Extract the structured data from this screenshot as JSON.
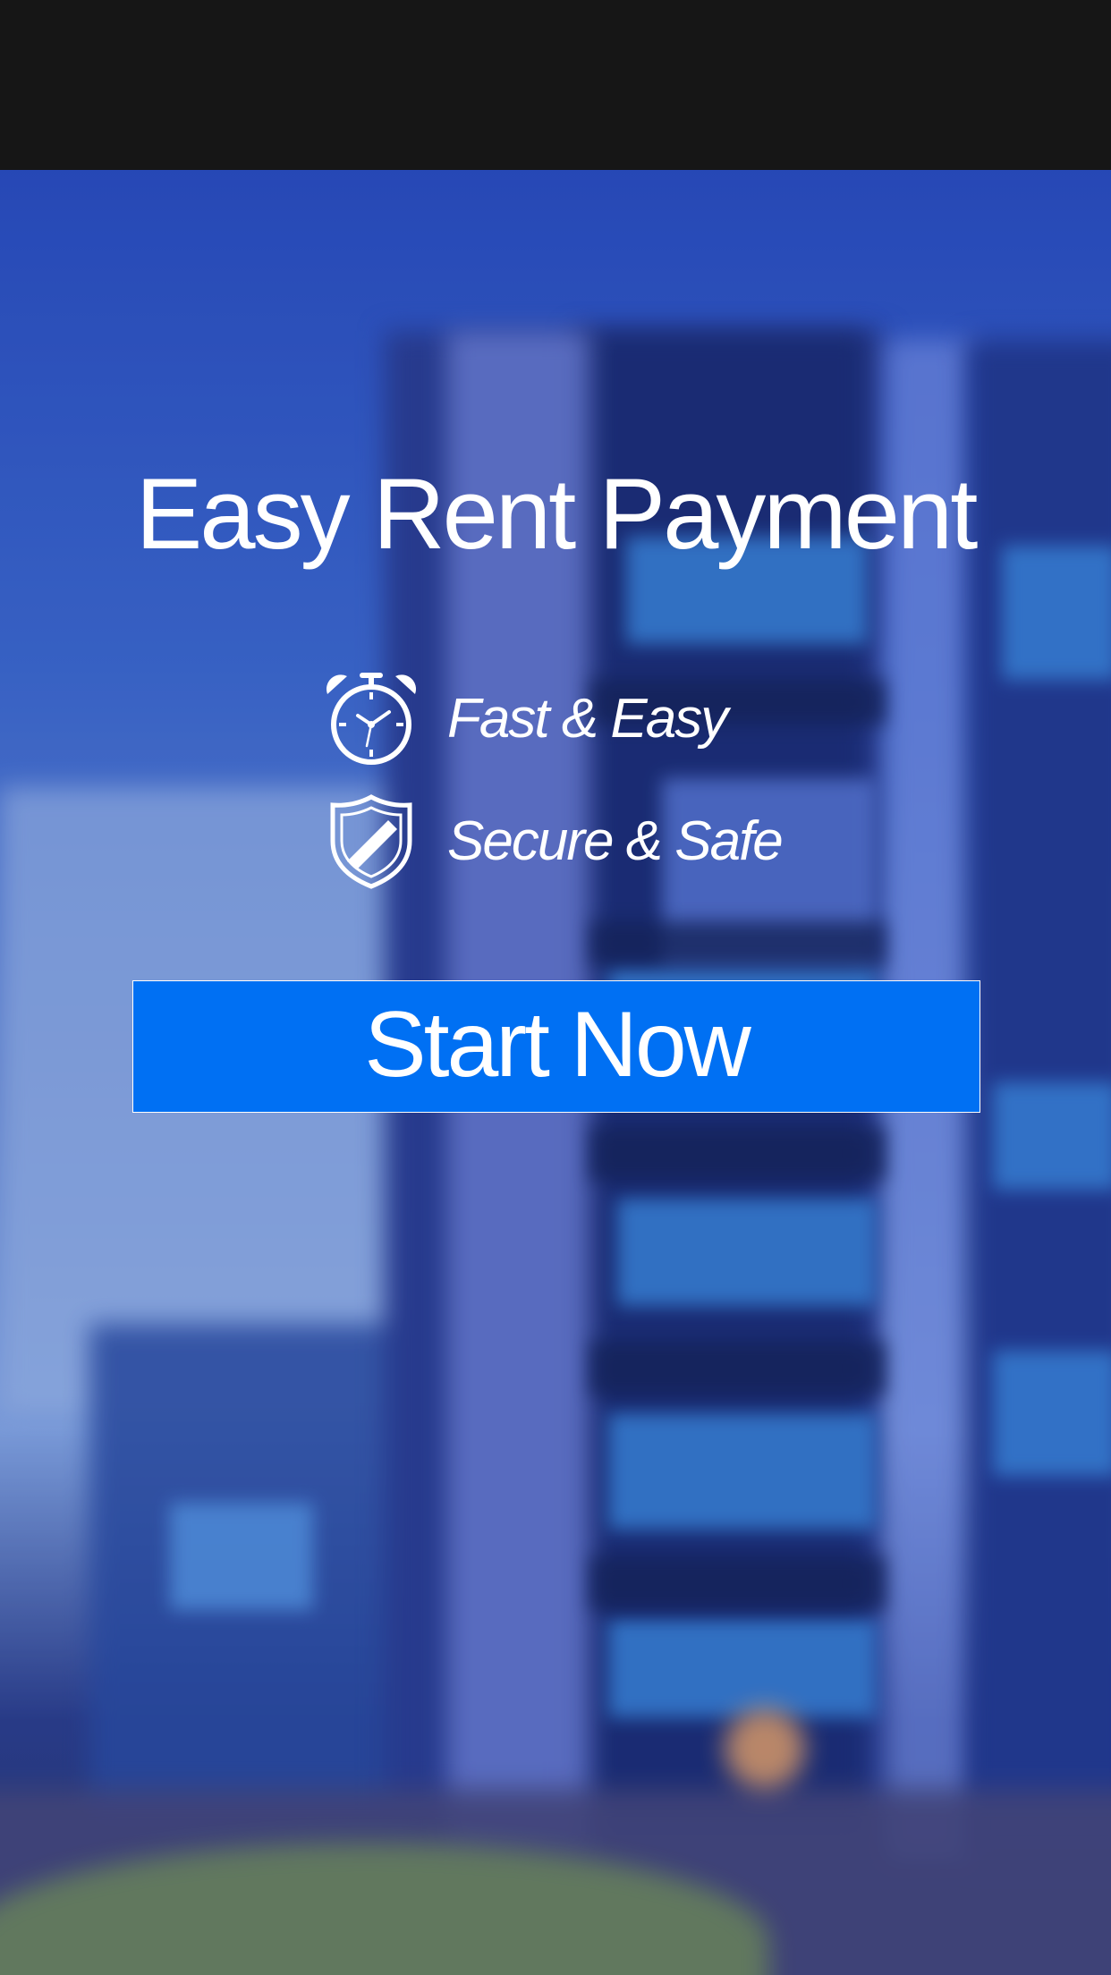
{
  "hero": {
    "title": "Easy Rent Payment"
  },
  "features": [
    {
      "icon": "stopwatch-icon",
      "label": "Fast & Easy"
    },
    {
      "icon": "shield-icon",
      "label": "Secure & Safe"
    }
  ],
  "cta": {
    "label": "Start Now",
    "color": "#0070f3"
  },
  "colors": {
    "status_bar": "#161616",
    "text": "#ffffff"
  }
}
